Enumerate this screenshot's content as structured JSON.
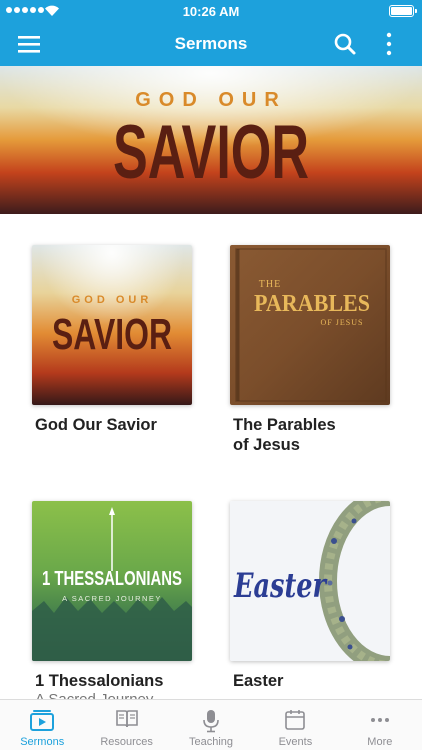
{
  "status_bar": {
    "time": "10:26 AM"
  },
  "header": {
    "title": "Sermons"
  },
  "hero": {
    "line1": "GOD OUR",
    "line2": "SAVIOR"
  },
  "series": [
    {
      "title": "God Our Savior",
      "art_line1": "GOD OUR",
      "art_line2": "SAVIOR"
    },
    {
      "title": "The Parables\nof Jesus",
      "art_line1": "THE",
      "art_line2": "PARABLES",
      "art_line3": "OF JESUS"
    },
    {
      "title": "1 Thessalonians",
      "subtitle": "A Sacred Journey",
      "art_line1": "1 THESSALONIANS",
      "art_line2": "A SACRED JOURNEY"
    },
    {
      "title": "Easter",
      "art_line1": "Easter"
    }
  ],
  "tabs": [
    {
      "label": "Sermons",
      "icon": "video-icon",
      "active": true
    },
    {
      "label": "Resources",
      "icon": "book-icon",
      "active": false
    },
    {
      "label": "Teaching",
      "icon": "microphone-icon",
      "active": false
    },
    {
      "label": "Events",
      "icon": "calendar-icon",
      "active": false
    },
    {
      "label": "More",
      "icon": "more-dots-icon",
      "active": false
    }
  ],
  "colors": {
    "accent": "#1da1dc",
    "tab_inactive": "#8e8e93"
  }
}
